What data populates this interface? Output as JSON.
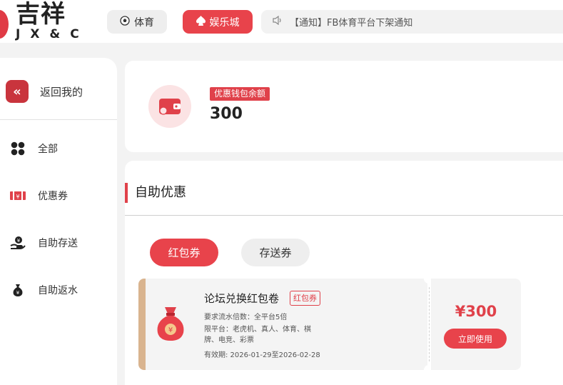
{
  "header": {
    "logo_cn": "吉祥",
    "logo_en": "JX&C",
    "nav": [
      {
        "label": "体育",
        "icon": "soccer-ball-icon"
      },
      {
        "label": "娱乐城",
        "icon": "spade-icon"
      }
    ],
    "notice": {
      "icon": "speaker-icon",
      "text": "【通知】FB体育平台下架通知"
    }
  },
  "sidebar": {
    "back_label": "返回我的",
    "items": [
      {
        "label": "全部",
        "icon": "grid-icon"
      },
      {
        "label": "优惠券",
        "icon": "ticket-icon"
      },
      {
        "label": "自助存送",
        "icon": "deposit-hand-icon"
      },
      {
        "label": "自助返水",
        "icon": "rebate-bag-icon"
      }
    ]
  },
  "balance": {
    "label": "优惠钱包余额",
    "value": "300",
    "icon": "wallet-icon"
  },
  "main": {
    "section_title": "自助优惠",
    "tabs": [
      {
        "label": "红包券",
        "active": true
      },
      {
        "label": "存送券",
        "active": false
      }
    ]
  },
  "coupon": {
    "title": "论坛兑换红包卷",
    "tag": "红包券",
    "requirement": "要求流水倍数：全平台5倍",
    "platform": "限平台：老虎机、真人、体育、棋牌、电竞、彩票",
    "validity": "有效期: 2026-01-29至2026-02-28",
    "amount": "¥300",
    "use_label": "立即使用",
    "icon": "money-bag-icon"
  },
  "colors": {
    "accent": "#e8434b",
    "strip": "#d9b48f",
    "back_button": "#c9343d"
  }
}
